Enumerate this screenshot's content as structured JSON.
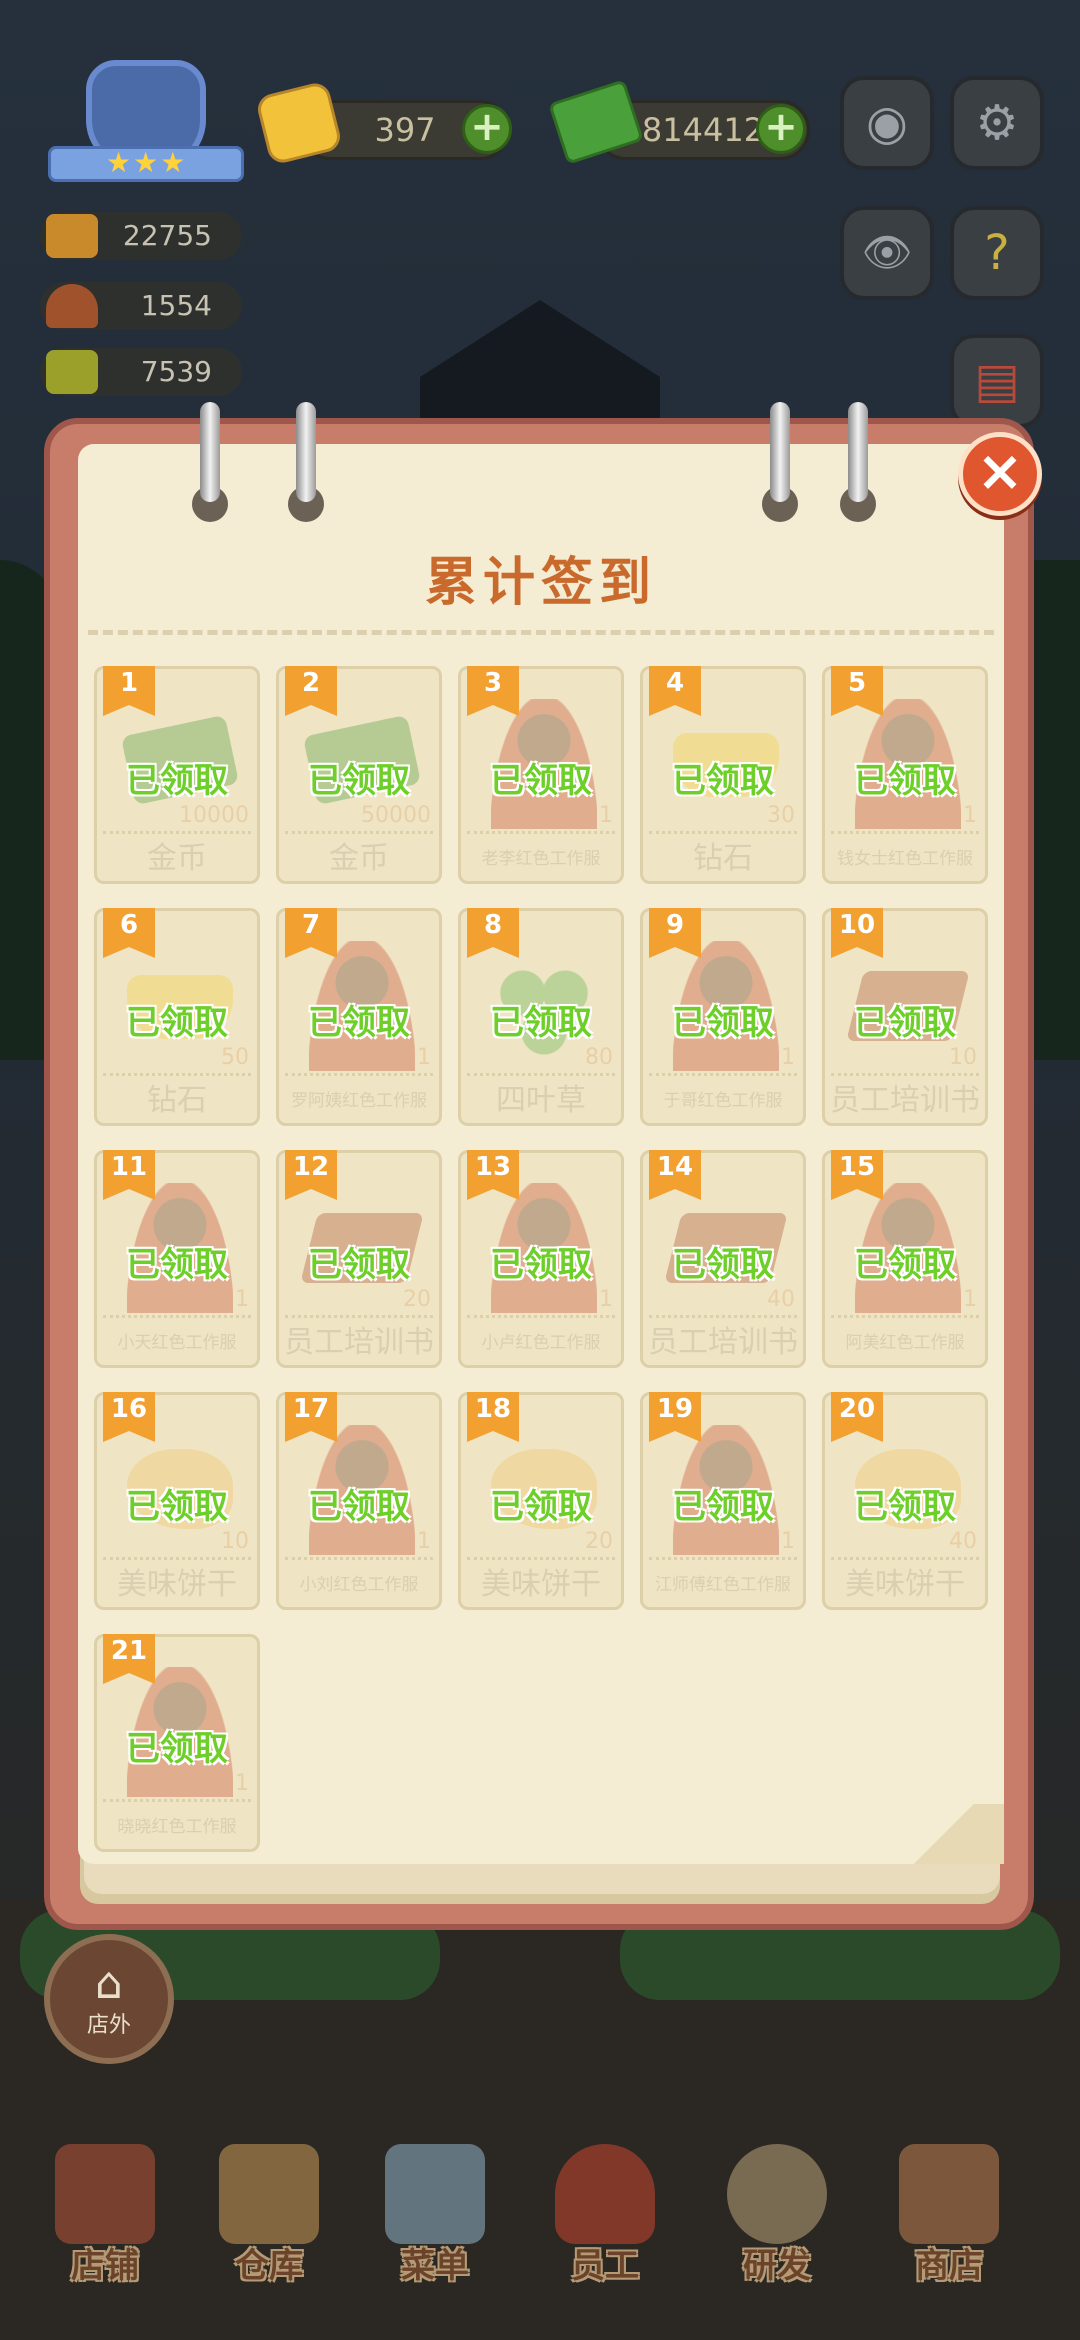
{
  "hud": {
    "stars": "★★★",
    "diamonds": "397",
    "cash": "814412",
    "plus": "+",
    "stats": [
      {
        "icon": "table-icon",
        "value": "22755"
      },
      {
        "icon": "cloche-icon",
        "value": "1554"
      },
      {
        "icon": "book-icon",
        "value": "7539"
      }
    ],
    "buttons": {
      "camera": "◉",
      "settings": "⚙",
      "eye": "👁",
      "help": "?",
      "book": "▤"
    }
  },
  "panel": {
    "title": "累计签到",
    "close": "×",
    "claimed_label": "已领取",
    "rewards": [
      {
        "day": "1",
        "qty": "10000",
        "name": "金币",
        "art": "money"
      },
      {
        "day": "2",
        "qty": "50000",
        "name": "金币",
        "art": "money"
      },
      {
        "day": "3",
        "qty": "1",
        "name": "老李红色工作服",
        "art": "person"
      },
      {
        "day": "4",
        "qty": "30",
        "name": "钻石",
        "art": "gem"
      },
      {
        "day": "5",
        "qty": "1",
        "name": "钱女士红色工作服",
        "art": "person"
      },
      {
        "day": "6",
        "qty": "50",
        "name": "钻石",
        "art": "gem"
      },
      {
        "day": "7",
        "qty": "1",
        "name": "罗阿姨红色工作服",
        "art": "person"
      },
      {
        "day": "8",
        "qty": "80",
        "name": "四叶草",
        "art": "clover"
      },
      {
        "day": "9",
        "qty": "1",
        "name": "于哥红色工作服",
        "art": "person"
      },
      {
        "day": "10",
        "qty": "10",
        "name": "员工培训书",
        "art": "book"
      },
      {
        "day": "11",
        "qty": "1",
        "name": "小天红色工作服",
        "art": "person"
      },
      {
        "day": "12",
        "qty": "20",
        "name": "员工培训书",
        "art": "book"
      },
      {
        "day": "13",
        "qty": "1",
        "name": "小卢红色工作服",
        "art": "person"
      },
      {
        "day": "14",
        "qty": "40",
        "name": "员工培训书",
        "art": "book"
      },
      {
        "day": "15",
        "qty": "1",
        "name": "阿美红色工作服",
        "art": "person"
      },
      {
        "day": "16",
        "qty": "10",
        "name": "美味饼干",
        "art": "cookie"
      },
      {
        "day": "17",
        "qty": "1",
        "name": "小刘红色工作服",
        "art": "person"
      },
      {
        "day": "18",
        "qty": "20",
        "name": "美味饼干",
        "art": "cookie"
      },
      {
        "day": "19",
        "qty": "1",
        "name": "江师傅红色工作服",
        "art": "person"
      },
      {
        "day": "20",
        "qty": "40",
        "name": "美味饼干",
        "art": "cookie"
      },
      {
        "day": "21",
        "qty": "1",
        "name": "晓晓红色工作服",
        "art": "person"
      }
    ]
  },
  "outside": {
    "label": "店外"
  },
  "nav": [
    {
      "label": "店铺",
      "icon": "shop-icon",
      "color": "#b8553a"
    },
    {
      "label": "仓库",
      "icon": "warehouse-icon",
      "color": "#c99a5a"
    },
    {
      "label": "菜单",
      "icon": "menu-icon",
      "color": "#8fb4c8"
    },
    {
      "label": "员工",
      "icon": "staff-icon",
      "color": "#c8472e"
    },
    {
      "label": "研发",
      "icon": "research-icon",
      "color": "#b9a27a"
    },
    {
      "label": "商店",
      "icon": "store-icon",
      "color": "#c08050"
    }
  ]
}
